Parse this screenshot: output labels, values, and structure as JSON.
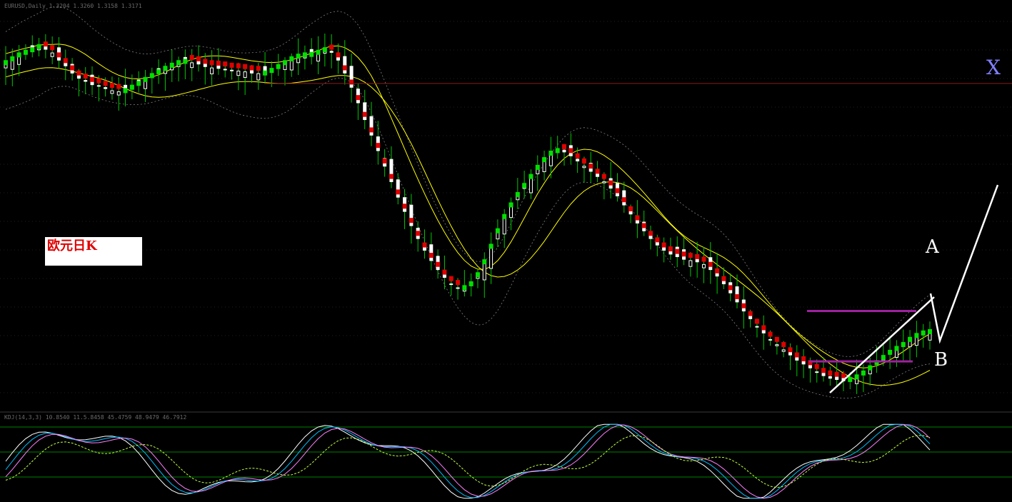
{
  "chart_data": {
    "type": "candlestick",
    "title": "欧元日K",
    "symbol_header": "EURUSD,Daily  1.3204 1.3260 1.3158 1.3171",
    "indicator_header": "KDJ(14,3,3)  10.8540  11.5.8458  45.4759  48.9479  46.7912",
    "annotations": {
      "A": "A",
      "B": "B",
      "X": "X"
    },
    "colors": {
      "background": "#000000",
      "candle": "#ffffff",
      "wick": "#00c800",
      "heiken_up": "#00e000",
      "heiken_down": "#e00000",
      "ma": "#ffff00",
      "band": "#808080",
      "resistance": "#8b1a1a",
      "range_line": "#a020a0",
      "trend_line": "#ffffff",
      "x_label": "#8080ff",
      "osc_k": "#ffffff",
      "osc_d": "#00bfff",
      "osc_j": "#ff80ff",
      "osc_ma": "#c0ff40",
      "osc_level": "#008000",
      "title_text": "#e00000",
      "title_box": "#ffffff"
    },
    "series_close": [
      1.356,
      1.3575,
      1.359,
      1.36,
      1.361,
      1.3622,
      1.3612,
      1.3598,
      1.357,
      1.3548,
      1.352,
      1.35,
      1.3488,
      1.3475,
      1.347,
      1.346,
      1.3452,
      1.3448,
      1.3452,
      1.3465,
      1.348,
      1.3495,
      1.351,
      1.3525,
      1.3538,
      1.355,
      1.356,
      1.3565,
      1.356,
      1.3555,
      1.3545,
      1.354,
      1.3538,
      1.3535,
      1.353,
      1.3528,
      1.3525,
      1.352,
      1.3518,
      1.352,
      1.353,
      1.3545,
      1.356,
      1.3575,
      1.3585,
      1.359,
      1.3592,
      1.36,
      1.361,
      1.36,
      1.357,
      1.352,
      1.3465,
      1.3405,
      1.334,
      1.328,
      1.322,
      1.316,
      1.31,
      1.304,
      1.2985,
      1.293,
      1.288,
      1.2835,
      1.2795,
      1.276,
      1.273,
      1.2705,
      1.269,
      1.269,
      1.2705,
      1.274,
      1.279,
      1.285,
      1.291,
      1.2965,
      1.301,
      1.305,
      1.3085,
      1.312,
      1.3155,
      1.3185,
      1.321,
      1.322,
      1.3215,
      1.32,
      1.318,
      1.316,
      1.314,
      1.312,
      1.31,
      1.3075,
      1.3045,
      1.301,
      1.2975,
      1.294,
      1.291,
      1.288,
      1.2855,
      1.2835,
      1.282,
      1.281,
      1.28,
      1.2795,
      1.279,
      1.278,
      1.276,
      1.2735,
      1.2705,
      1.267,
      1.2635,
      1.26,
      1.257,
      1.254,
      1.2515,
      1.249,
      1.247,
      1.245,
      1.243,
      1.241,
      1.2395,
      1.238,
      1.2365,
      1.235,
      1.234,
      1.2335,
      1.233,
      1.2335,
      1.2345,
      1.236,
      1.238,
      1.24,
      1.242,
      1.244,
      1.2455,
      1.247,
      1.249,
      1.2505,
      1.2515,
      1.252
    ],
    "resistance_level": 1.348,
    "range_top": 1.26,
    "range_bottom": 1.2405,
    "ylim": [
      1.2215,
      1.3775
    ]
  }
}
